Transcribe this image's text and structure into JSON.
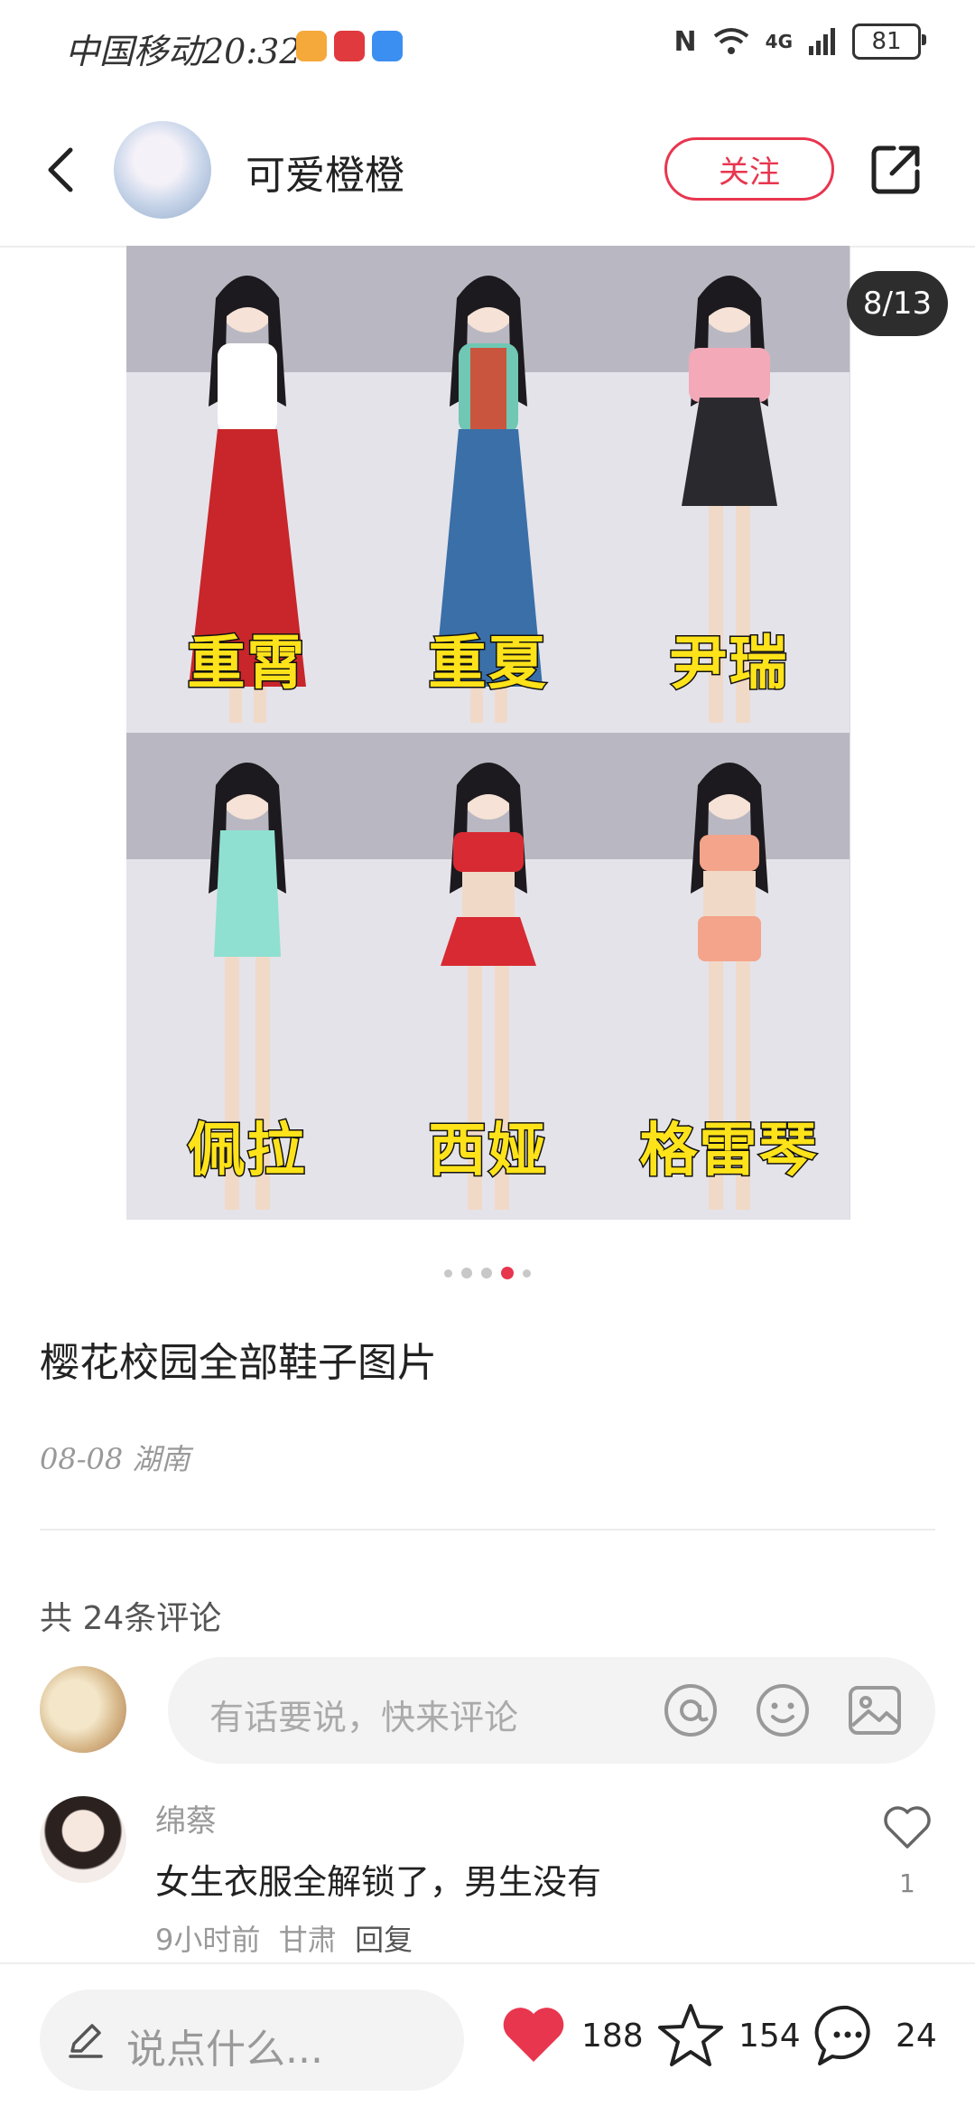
{
  "status": {
    "carrier_time": "中国移动20:32",
    "signal_text": "4G",
    "battery": "81"
  },
  "header": {
    "author": "可爱橙橙",
    "follow_label": "关注"
  },
  "media": {
    "counter": "8/13",
    "captions": [
      "重霄",
      "重夏",
      "尹瑞",
      "佩拉",
      "西娅",
      "格雷琴"
    ],
    "outfit_colors": [
      "#c8262a",
      "#3a6fa8",
      "#f3a9b8",
      "#8fe0d0",
      "#d82a32",
      "#f4a48a"
    ]
  },
  "post": {
    "title": "樱花校园全部鞋子图片",
    "date_location": "08-08 湖南",
    "comment_count": "共 24条评论"
  },
  "comment_input": {
    "placeholder": "有话要说，快来评论"
  },
  "comments": [
    {
      "name": "绵蔡",
      "text": "女生衣服全解锁了，男生没有",
      "time": "9小时前",
      "location": "甘肃",
      "reply": "回复",
      "likes": "1"
    }
  ],
  "bottom_bar": {
    "input_placeholder": "说点什么...",
    "likes": "188",
    "favorites": "154",
    "comments": "24",
    "accent": "#e8364f"
  }
}
